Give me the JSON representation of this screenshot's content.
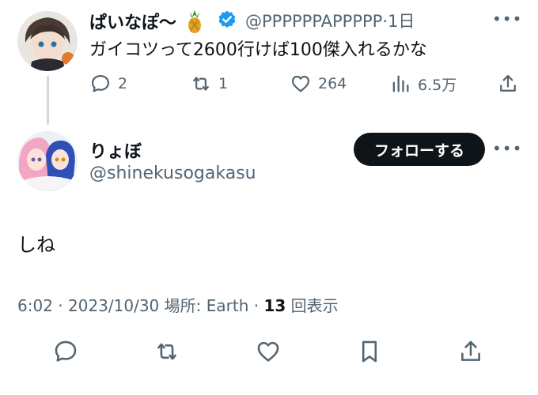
{
  "parent_tweet": {
    "display_name": "ぱいなぽ〜",
    "handle": "@PPPPPPAPPPPP",
    "separator": "·",
    "time_ago": "1日",
    "text": "ガイコツって2600行けば100傑入れるかな",
    "actions": {
      "reply_count": "2",
      "retweet_count": "1",
      "like_count": "264",
      "view_count": "6.5万"
    }
  },
  "main_tweet": {
    "display_name": "りょぼ",
    "handle": "@shinekusogakasu",
    "follow_label": "フォローする",
    "text": "しね",
    "meta": {
      "time": "6:02",
      "date": "2023/10/30",
      "location": "場所: Earth",
      "view_count": "13",
      "view_label": "回表示"
    }
  },
  "colors": {
    "text_primary": "#0f1419",
    "text_secondary": "#536471",
    "verified_blue": "#1d9bf0",
    "thread_line": "#cfd9de"
  },
  "icons": {
    "reply": "speech-bubble-icon",
    "retweet": "retweet-arrows-icon",
    "like": "heart-icon",
    "views": "bar-chart-icon",
    "share": "share-upload-icon",
    "bookmark": "bookmark-icon",
    "more": "more-dots-icon",
    "verified": "verified-badge-icon",
    "pineapple": "pineapple-emoji-icon"
  }
}
